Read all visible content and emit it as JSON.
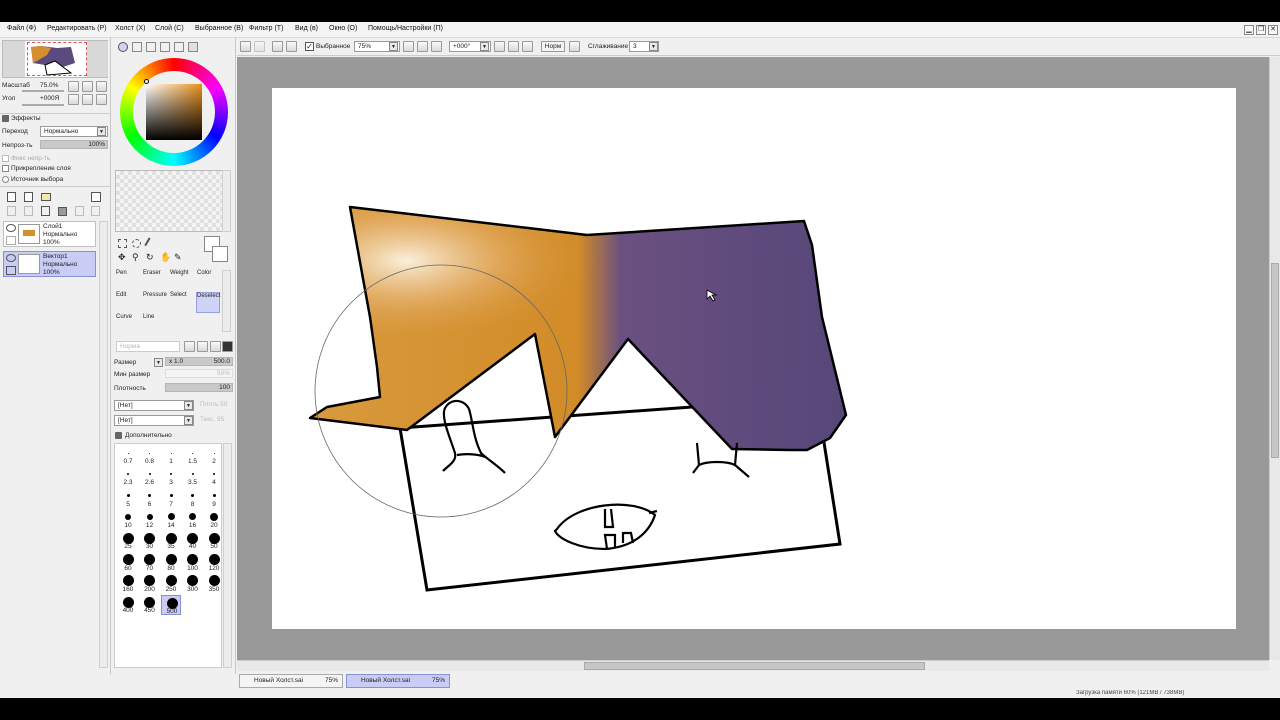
{
  "menu": {
    "items": [
      "Файл (Ф)",
      "Редактировать (Р)",
      "Холст (Х)",
      "Слой (С)",
      "Выбранное (В)",
      "Фильтр (Т)",
      "Вид (в)",
      "Окно (О)",
      "Помощь/Настройки (П)"
    ]
  },
  "nav": {
    "zoom_label": "Масштаб",
    "zoom_value": "75.0%",
    "angle_label": "Угол",
    "angle_value": "+000Я"
  },
  "effects": {
    "title": "Эффекты",
    "blend_label": "Переход",
    "blend_value": "Нормально",
    "opacity_label": "Непроз-ть",
    "opacity_value": "100%",
    "opacity_fraction": 1.0,
    "protect_label": "Фикс непр-ть",
    "clip_label": "Прикрепление слоя",
    "source_label": "Источник выбора"
  },
  "layers": [
    {
      "name": "Слой1",
      "mode": "Нормально",
      "opacity": "100%",
      "selected": false
    },
    {
      "name": "Вектор1",
      "mode": "Нормально",
      "opacity": "100%",
      "selected": true
    }
  ],
  "toolbar": {
    "selected_label": "Выбранное",
    "zoom": "75%",
    "angle": "+000°",
    "mode": "Норм",
    "smoothing_label": "Сглаживание",
    "smoothing_value": "3"
  },
  "tools": {
    "row1": [
      "Pen",
      "Eraser",
      "Weight",
      "Color"
    ],
    "row2": [
      "Edit",
      "Pressure",
      "Select",
      "Deselect"
    ],
    "row3": [
      "Curve",
      "Line"
    ],
    "selected": "Deselect"
  },
  "brush": {
    "mode_placeholder": "Норма",
    "size_label": "Размер",
    "size_mult": "x 1.0",
    "size_value": "500.0",
    "min_size_label": "Мин размер",
    "min_size_value": "50%",
    "density_label": "Плотность",
    "density_value": "100",
    "density_fraction": 1.0,
    "shape1": "[Нет]",
    "shape1_right": "Плоть 50",
    "shape2": "[Нет]",
    "shape2_right": "Текс. 95",
    "advanced_label": "Дополнительно",
    "sizes": [
      "0.7",
      "0.8",
      "1",
      "1.5",
      "2",
      "2.3",
      "2.6",
      "3",
      "3.5",
      "4",
      "5",
      "6",
      "7",
      "8",
      "9",
      "10",
      "12",
      "14",
      "16",
      "20",
      "25",
      "30",
      "35",
      "40",
      "50",
      "60",
      "70",
      "80",
      "100",
      "120",
      "160",
      "200",
      "250",
      "300",
      "350",
      "400",
      "450",
      "500"
    ],
    "selected_size": "500"
  },
  "tabs": [
    {
      "name": "Новый Холст.sai",
      "zoom": "75%",
      "selected": false
    },
    {
      "name": "Новый Холст.sai",
      "zoom": "75%",
      "selected": true
    }
  ],
  "status": {
    "memory": "Загрузка памяти 60% (121MB / 738MB)"
  },
  "colors": {
    "hat_orange": "#d48f2e",
    "hat_purple": "#5b4a7e",
    "highlight": "#f3d9b0",
    "canvas_bg": "#999999",
    "selection_blue": "#c9ccf5"
  },
  "icons": [
    "eye-icon",
    "pen-icon",
    "eraser-icon",
    "hand-icon",
    "zoom-icon",
    "rotate-icon",
    "eyedropper-icon",
    "new-layer-icon",
    "trash-icon"
  ]
}
